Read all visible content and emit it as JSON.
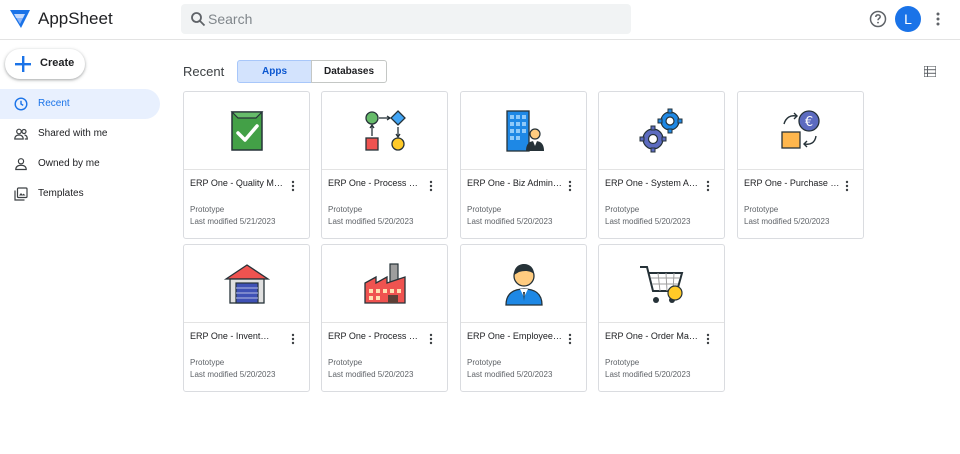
{
  "app": {
    "title": "AppSheet"
  },
  "search": {
    "placeholder": "Search"
  },
  "user": {
    "initial": "L"
  },
  "sidebar": {
    "create_label": "Create",
    "items": [
      {
        "label": "Recent",
        "icon": "clock-icon",
        "active": true
      },
      {
        "label": "Shared with me",
        "icon": "people-icon",
        "active": false
      },
      {
        "label": "Owned by me",
        "icon": "person-icon",
        "active": false
      },
      {
        "label": "Templates",
        "icon": "templates-icon",
        "active": false
      }
    ]
  },
  "main": {
    "title": "Recent",
    "tabs": [
      {
        "label": "Apps",
        "selected": true
      },
      {
        "label": "Databases",
        "selected": false
      }
    ],
    "cards": [
      {
        "name": "ERP One - Quality Ma…",
        "status": "Prototype",
        "modified": "Last modified 5/21/2023",
        "icon": "quality-check-icon"
      },
      {
        "name": "ERP One - Process D…",
        "status": "Prototype",
        "modified": "Last modified 5/20/2023",
        "icon": "process-flow-icon"
      },
      {
        "name": "ERP One - Biz Admin…",
        "status": "Prototype",
        "modified": "Last modified 5/20/2023",
        "icon": "office-building-icon"
      },
      {
        "name": "ERP One - System Ad…",
        "status": "Prototype",
        "modified": "Last modified 5/20/2023",
        "icon": "gears-icon"
      },
      {
        "name": "ERP One - Purchase …",
        "status": "Prototype",
        "modified": "Last modified 5/20/2023",
        "icon": "purchase-exchange-icon"
      },
      {
        "name": "ERP One - Invent…",
        "status": "Prototype",
        "modified": "Last modified 5/20/2023",
        "icon": "warehouse-icon"
      },
      {
        "name": "ERP One - Process M…",
        "status": "Prototype",
        "modified": "Last modified 5/20/2023",
        "icon": "factory-icon"
      },
      {
        "name": "ERP One - Employee …",
        "status": "Prototype",
        "modified": "Last modified 5/20/2023",
        "icon": "employee-icon"
      },
      {
        "name": "ERP One - Order Man…",
        "status": "Prototype",
        "modified": "Last modified 5/20/2023",
        "icon": "shopping-cart-icon"
      }
    ]
  },
  "colors": {
    "accent": "#1a73e8",
    "active_nav_bg": "#e8f0fe",
    "selected_tab_bg": "#d3e3fd"
  }
}
